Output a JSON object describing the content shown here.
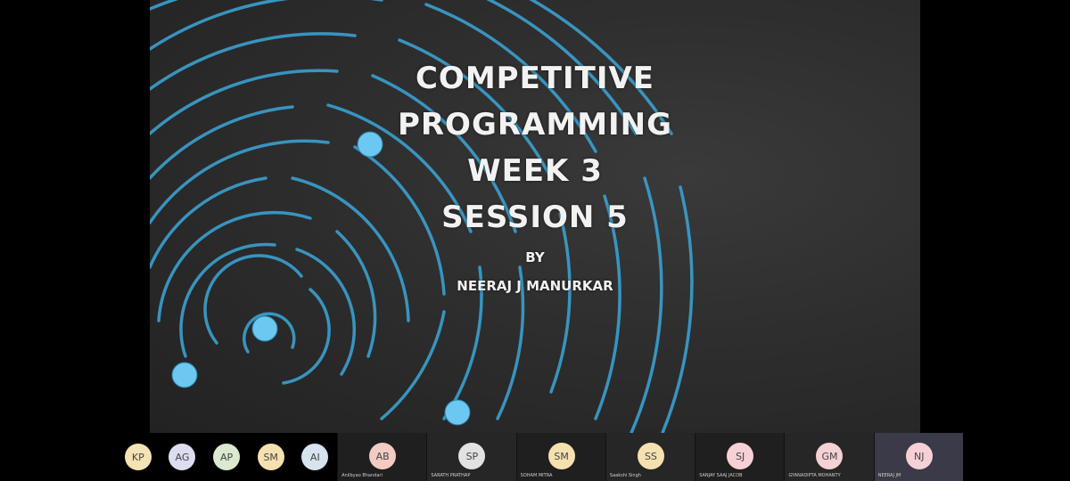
{
  "slide": {
    "title_lines": [
      "COMPETITIVE",
      "PROGRAMMING",
      "WEEK 3",
      "SESSION 5"
    ],
    "by": "BY",
    "author": "NEERAJ J MANURKAR"
  },
  "participants_small": [
    {
      "initials": "KP",
      "color": "#f3e3b5"
    },
    {
      "initials": "AG",
      "color": "#dcdcf2"
    },
    {
      "initials": "AP",
      "color": "#dbe9cf"
    },
    {
      "initials": "SM",
      "color": "#f5e1b0"
    },
    {
      "initials": "AI",
      "color": "#d7e3ee"
    }
  ],
  "participants_large": [
    {
      "initials": "AB",
      "name": "Anilbyao Bhandari",
      "color": "#f3cbc2"
    },
    {
      "initials": "SP",
      "name": "SARATH PRATHAP",
      "color": "#e2e2e2"
    },
    {
      "initials": "SM",
      "name": "SOHAM MITRA",
      "color": "#f5e1b0"
    },
    {
      "initials": "SS",
      "name": "Saakshi Singh",
      "color": "#f5e1b0"
    },
    {
      "initials": "SJ",
      "name": "SANJAY SAAJ JACOB",
      "color": "#f5d0d4"
    },
    {
      "initials": "GM",
      "name": "GYANADIPTA MOHANTY",
      "color": "#f5d0d4"
    },
    {
      "initials": "NJ",
      "name": "NEERAJ JM",
      "color": "#f5d0d4"
    }
  ]
}
